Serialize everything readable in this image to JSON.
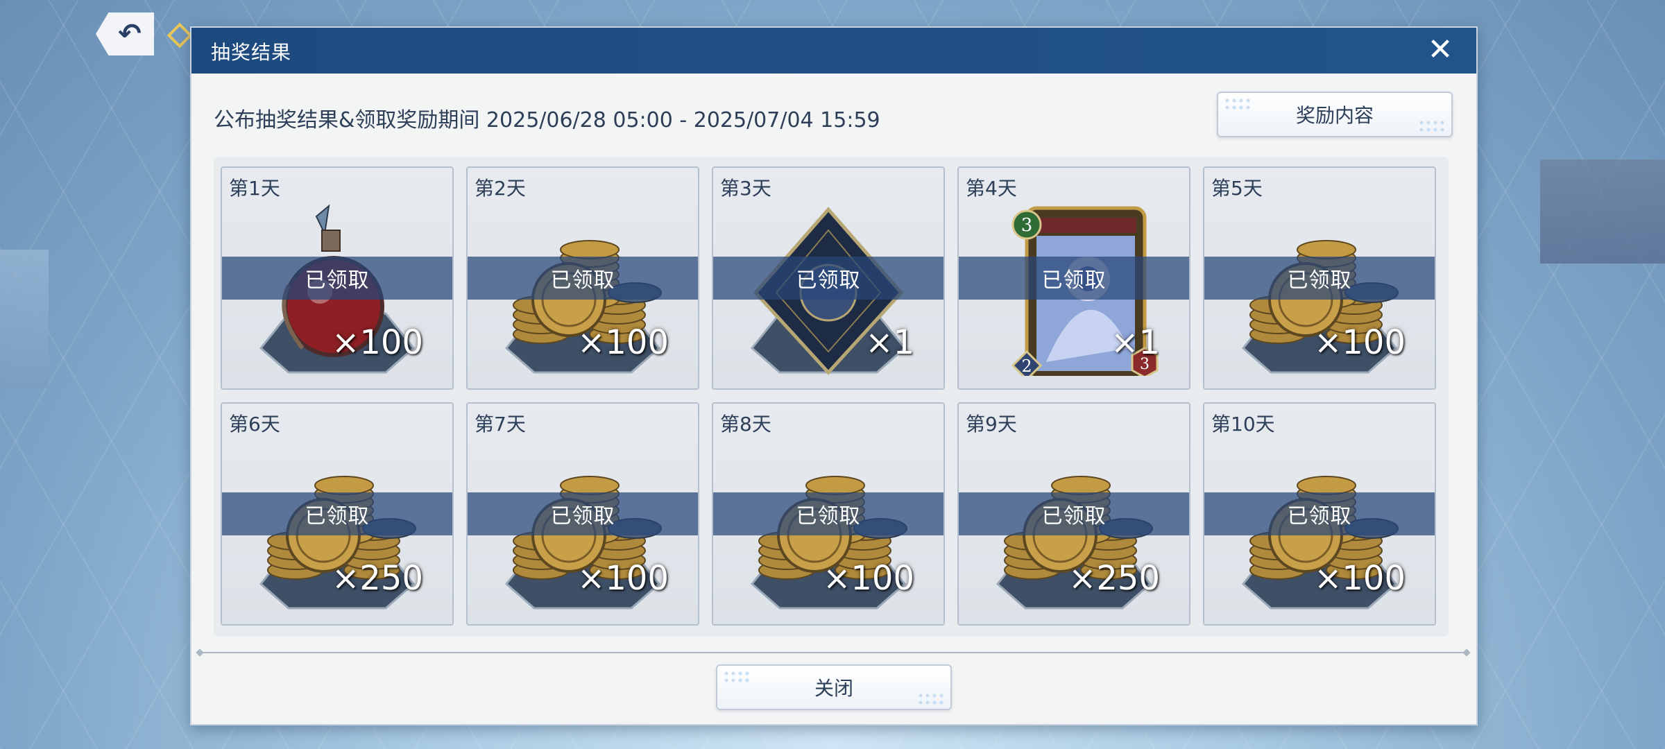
{
  "header": {
    "title": "抽奖结果",
    "close_icon": "close-icon"
  },
  "period": {
    "text": "公布抽奖结果&领取奖励期间 2025/06/28 05:00 - 2025/07/04 15:59"
  },
  "buttons": {
    "reward_content": "奖励内容",
    "close": "关闭"
  },
  "rewards": [
    {
      "day": "第1天",
      "item": "potion",
      "qty": "×100",
      "status": "已领取"
    },
    {
      "day": "第2天",
      "item": "coins",
      "qty": "×100",
      "status": "已领取"
    },
    {
      "day": "第3天",
      "item": "card-pack",
      "qty": "×1",
      "status": "已领取"
    },
    {
      "day": "第4天",
      "item": "character-card",
      "qty": "×1",
      "status": "已领取"
    },
    {
      "day": "第5天",
      "item": "coins",
      "qty": "×100",
      "status": "已领取"
    },
    {
      "day": "第6天",
      "item": "coins",
      "qty": "×250",
      "status": "已领取"
    },
    {
      "day": "第7天",
      "item": "coins",
      "qty": "×100",
      "status": "已领取"
    },
    {
      "day": "第8天",
      "item": "coins",
      "qty": "×100",
      "status": "已领取"
    },
    {
      "day": "第9天",
      "item": "coins",
      "qty": "×250",
      "status": "已领取"
    },
    {
      "day": "第10天",
      "item": "coins",
      "qty": "×100",
      "status": "已领取"
    }
  ],
  "colors": {
    "header": "#1d4a7e",
    "claimed_band": "#28467a",
    "dialog_bg": "#f3f4f4"
  }
}
